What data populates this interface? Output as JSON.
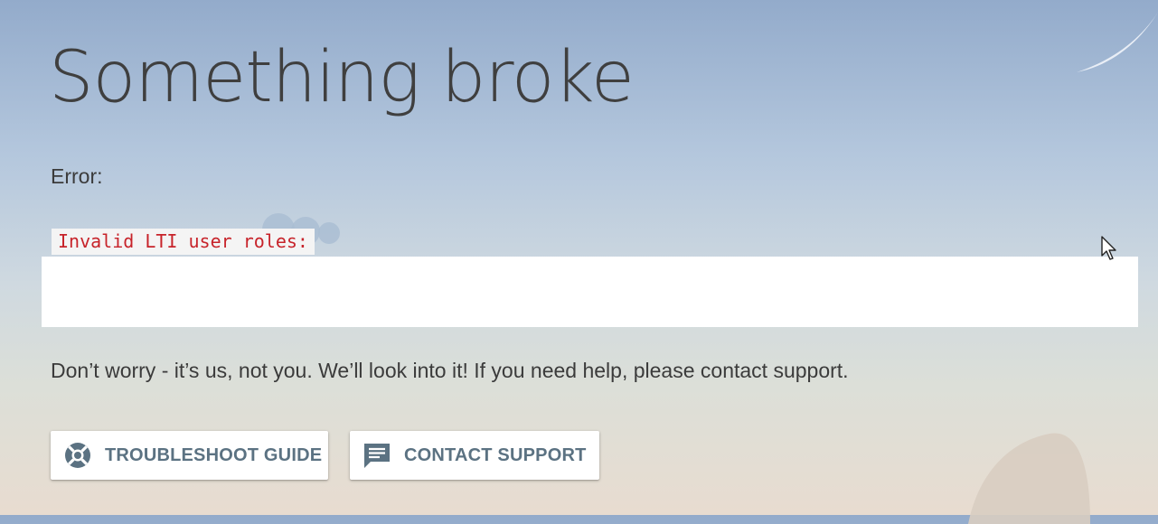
{
  "page": {
    "title": "Something broke",
    "error_label": "Error:",
    "error_code": "Invalid LTI user roles:",
    "error_details": "",
    "message": "Don’t worry - it’s us, not you. We’ll look into it! If you need help, please contact support."
  },
  "buttons": {
    "troubleshoot": {
      "label": "TROUBLESHOOT GUIDE",
      "icon": "lifebuoy-icon"
    },
    "contact": {
      "label": "CONTACT SUPPORT",
      "icon": "chat-icon"
    }
  },
  "colors": {
    "error_text": "#c7232a",
    "button_text": "#5b7282",
    "heading_text": "#3f3f3f"
  }
}
